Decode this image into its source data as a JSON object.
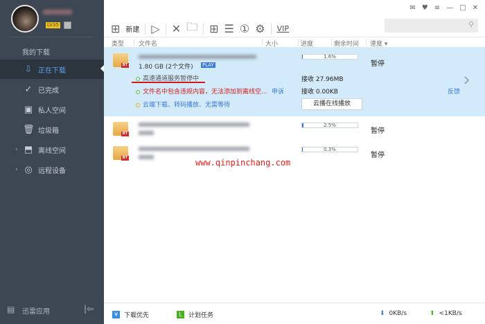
{
  "user": {
    "level": "LV35"
  },
  "sidebar": {
    "header": "我的下载",
    "items": [
      {
        "label": "正在下载",
        "icon": "download-icon"
      },
      {
        "label": "已完成",
        "icon": "check-circle-icon"
      },
      {
        "label": "私人空间",
        "icon": "lock-icon"
      },
      {
        "label": "垃圾箱",
        "icon": "trash-icon"
      },
      {
        "label": "离线空间",
        "icon": "cloud-download-icon"
      },
      {
        "label": "远程设备",
        "icon": "remote-device-icon"
      }
    ],
    "bottom_label": "迅雷应用"
  },
  "toolbar": {
    "new_label": "新建",
    "vip_label": "VIP"
  },
  "columns": [
    "类型",
    "文件名",
    "大小",
    "进度",
    "剩余时间",
    "速度 ▾"
  ],
  "tasks": [
    {
      "size": "1.80 GB (2个文件)",
      "progress": "1.6%",
      "progress_value": 1.6,
      "status": "暂停",
      "lines": {
        "hs": "高速通道服务暂停中",
        "offline": "文件名中包含违规内容，无法添加到离线空...",
        "appeal": "申诉",
        "cloud": "云端下载、转码播放、无需等待",
        "recv1": "接收 27.96MB",
        "recv2": "接收 0.00KB",
        "feedback": "反馈",
        "play_btn": "云播在线播放",
        "play_tag": "PLAY"
      }
    },
    {
      "progress": "2.5%",
      "progress_value": 2.5,
      "status": "暂停"
    },
    {
      "progress": "0.3%",
      "progress_value": 0.3,
      "status": "暂停"
    }
  ],
  "watermark": "www.qinpinchang.com",
  "footer": {
    "priority": "下载优先",
    "schedule": "计划任务",
    "down_speed": "0KB/s",
    "up_speed": "<1KB/s"
  }
}
